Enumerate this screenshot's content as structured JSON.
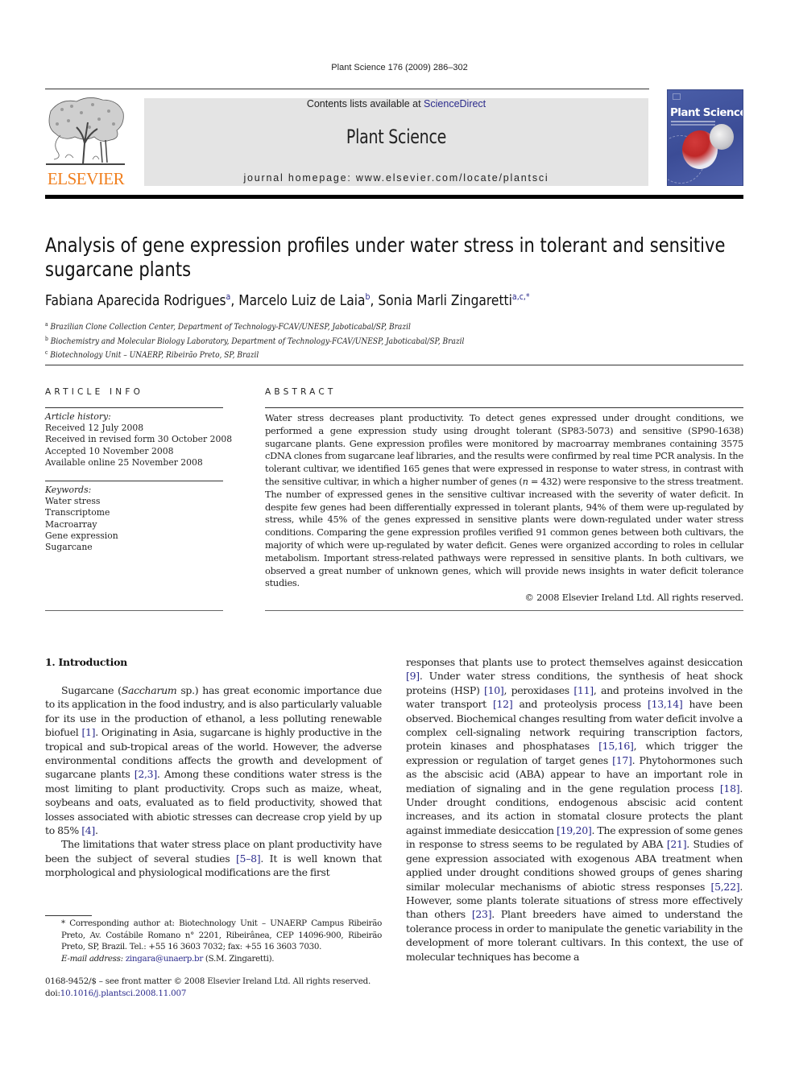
{
  "header": {
    "journal_ref": "Plant Science 176 (2009) 286–302",
    "publisher_logo_text": "ELSEVIER",
    "contents_prefix": "Contents lists available at ",
    "contents_link": "ScienceDirect",
    "journal_title": "Plant Science",
    "homepage_text": "journal homepage: www.elsevier.com/locate/plantsci",
    "cover_title": "Plant Science",
    "colors": {
      "publisher_orange": "#f07f1e",
      "masthead_bg": "#e4e4e4",
      "cover_blue": "#4a5ea8",
      "link_blue": "#2b2b8c"
    }
  },
  "article": {
    "title": "Analysis of gene expression profiles under water stress in tolerant and sensitive sugarcane plants",
    "authors": [
      {
        "name": "Fabiana Aparecida Rodrigues",
        "sup": "a",
        "sep": ", "
      },
      {
        "name": "Marcelo Luiz de Laia",
        "sup": "b",
        "sep": ", "
      },
      {
        "name": "Sonia Marli Zingaretti",
        "sup": "a,c,*",
        "sep": ""
      }
    ],
    "affiliations": [
      {
        "mark": "a",
        "text": "Brazilian Clone Collection Center, Department of Technology-FCAV/UNESP, Jaboticabal/SP, Brazil"
      },
      {
        "mark": "b",
        "text": "Biochemistry and Molecular Biology Laboratory, Department of Technology-FCAV/UNESP, Jaboticabal/SP, Brazil"
      },
      {
        "mark": "c",
        "text": "Biotechnology Unit – UNAERP, Ribeirão Preto, SP, Brazil"
      }
    ]
  },
  "article_info": {
    "heading": "ARTICLE INFO",
    "history_label": "Article history:",
    "history": [
      "Received 12 July 2008",
      "Received in revised form 30 October 2008",
      "Accepted 10 November 2008",
      "Available online 25 November 2008"
    ],
    "keywords_label": "Keywords:",
    "keywords": [
      "Water stress",
      "Transcriptome",
      "Macroarray",
      "Gene expression",
      "Sugarcane"
    ]
  },
  "abstract": {
    "heading": "ABSTRACT",
    "text_a": "Water stress decreases plant productivity. To detect genes expressed under drought conditions, we performed a gene expression study using drought tolerant (SP83-5073) and sensitive (SP90-1638) sugarcane plants. Gene expression profiles were monitored by macroarray membranes containing 3575 cDNA clones from sugarcane leaf libraries, and the results were confirmed by real time PCR analysis. In the tolerant cultivar, we identified 165 genes that were expressed in response to water stress, in contrast with the sensitive cultivar, in which a higher number of genes (",
    "text_n": "n",
    "text_b": " = 432) were responsive to the stress treatment. The number of expressed genes in the sensitive cultivar increased with the severity of water deficit. In despite few genes had been differentially expressed in tolerant plants, 94% of them were up-regulated by stress, while 45% of the genes expressed in sensitive plants were down-regulated under water stress conditions. Comparing the gene expression profiles verified 91 common genes between both cultivars, the majority of which were up-regulated by water deficit. Genes were organized according to roles in cellular metabolism. Important stress-related pathways were repressed in sensitive plants. In both cultivars, we observed a great number of unknown genes, which will provide news insights in water deficit tolerance studies.",
    "copyright": "© 2008 Elsevier Ireland Ltd. All rights reserved."
  },
  "intro": {
    "heading": "1.  Introduction",
    "p1": [
      {
        "t": "Sugarcane ("
      },
      {
        "t": "Saccharum",
        "i": true
      },
      {
        "t": " sp.) has great economic importance due to its application in the food industry, and is also particularly valuable for its use in the production of ethanol, a less polluting renewable biofuel "
      },
      {
        "t": "[1]",
        "c": true
      },
      {
        "t": ". Originating in Asia, sugarcane is highly productive in the tropical and sub-tropical areas of the world. However, the adverse environmental conditions affects the growth and development of sugarcane plants "
      },
      {
        "t": "[2,3]",
        "c": true
      },
      {
        "t": ". Among these conditions water stress is the most limiting to plant productivity. Crops such as maize, wheat, soybeans and oats, evaluated as to field productivity, showed that losses associated with abiotic stresses can decrease crop yield by up to 85% "
      },
      {
        "t": "[4]",
        "c": true
      },
      {
        "t": "."
      }
    ],
    "p2": [
      {
        "t": "The limitations that water stress place on plant productivity have been the subject of several studies "
      },
      {
        "t": "[5–8]",
        "c": true
      },
      {
        "t": ". It is well known that morphological and physiological modifications are the first"
      }
    ],
    "p3": [
      {
        "t": "responses that plants use to protect themselves against desiccation "
      },
      {
        "t": "[9]",
        "c": true
      },
      {
        "t": ". Under water stress conditions, the synthesis of heat shock proteins (HSP) "
      },
      {
        "t": "[10]",
        "c": true
      },
      {
        "t": ", peroxidases "
      },
      {
        "t": "[11]",
        "c": true
      },
      {
        "t": ", and proteins involved in the water transport "
      },
      {
        "t": "[12]",
        "c": true
      },
      {
        "t": " and proteolysis process "
      },
      {
        "t": "[13,14]",
        "c": true
      },
      {
        "t": " have been observed. Biochemical changes resulting from water deficit involve a complex cell-signaling network requiring transcription factors, protein kinases and phosphatases "
      },
      {
        "t": "[15,16]",
        "c": true
      },
      {
        "t": ", which trigger the expression or regulation of target genes "
      },
      {
        "t": "[17]",
        "c": true
      },
      {
        "t": ". Phytohormones such as the abscisic acid (ABA) appear to have an important role in mediation of signaling and in the gene regulation process "
      },
      {
        "t": "[18]",
        "c": true
      },
      {
        "t": ". Under drought conditions, endogenous abscisic acid content increases, and its action in stomatal closure protects the plant against immediate desiccation "
      },
      {
        "t": "[19,20]",
        "c": true
      },
      {
        "t": ". The expression of some genes in response to stress seems to be regulated by ABA "
      },
      {
        "t": "[21]",
        "c": true
      },
      {
        "t": ". Studies of gene expression associated with exogenous ABA treatment when applied under drought conditions showed groups of genes sharing similar molecular mechanisms of abiotic stress responses "
      },
      {
        "t": "[5,22]",
        "c": true
      },
      {
        "t": ". However, some plants tolerate situations of stress more effectively than others "
      },
      {
        "t": "[23]",
        "c": true
      },
      {
        "t": ". Plant breeders have aimed to understand the tolerance process in order to manipulate the genetic variability in the development of more tolerant cultivars. In this context, the use of molecular techniques has become a"
      }
    ]
  },
  "footnote": {
    "star": "* ",
    "corresponding": "Corresponding author at: Biotechnology Unit – UNAERP Campus Ribeirão Preto, Av. Costábile Romano n° 2201, Ribeirânea, CEP 14096-900, Ribeirão Preto, SP, Brazil. Tel.: +55 16 3603 7032; fax: +55 16 3603 7030.",
    "email_label": "E-mail address:",
    "email": "zingara@unaerp.br",
    "email_suffix": " (S.M. Zingaretti)."
  },
  "front_matter": {
    "issn_line": "0168-9452/$ – see front matter © 2008 Elsevier Ireland Ltd. All rights reserved.",
    "doi_prefix": "doi:",
    "doi": "10.1016/j.plantsci.2008.11.007"
  }
}
